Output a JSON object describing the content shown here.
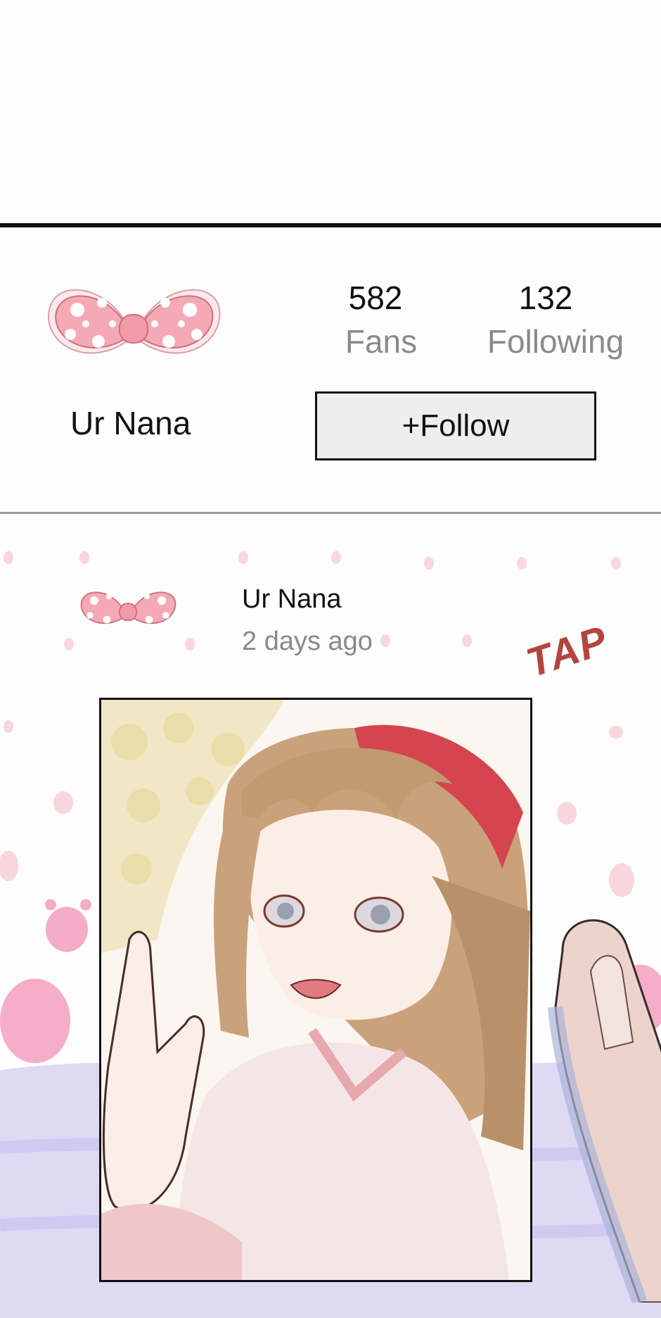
{
  "profile": {
    "fans_count": "582",
    "fans_label": "Fans",
    "following_count": "132",
    "following_label": "Following",
    "username": "Ur Nana",
    "follow_label": "+Follow"
  },
  "post": {
    "author": "Ur Nana",
    "time": "2 days ago",
    "sfx": "TAP"
  },
  "colors": {
    "bow_pink": "#f5a9b4",
    "bow_outline": "#c9707e",
    "tap_red": "#b5443e",
    "hair": "#c9a27b",
    "headband": "#d5454f"
  },
  "icons": {
    "avatar": "pink-polka-dot-bow-icon"
  }
}
